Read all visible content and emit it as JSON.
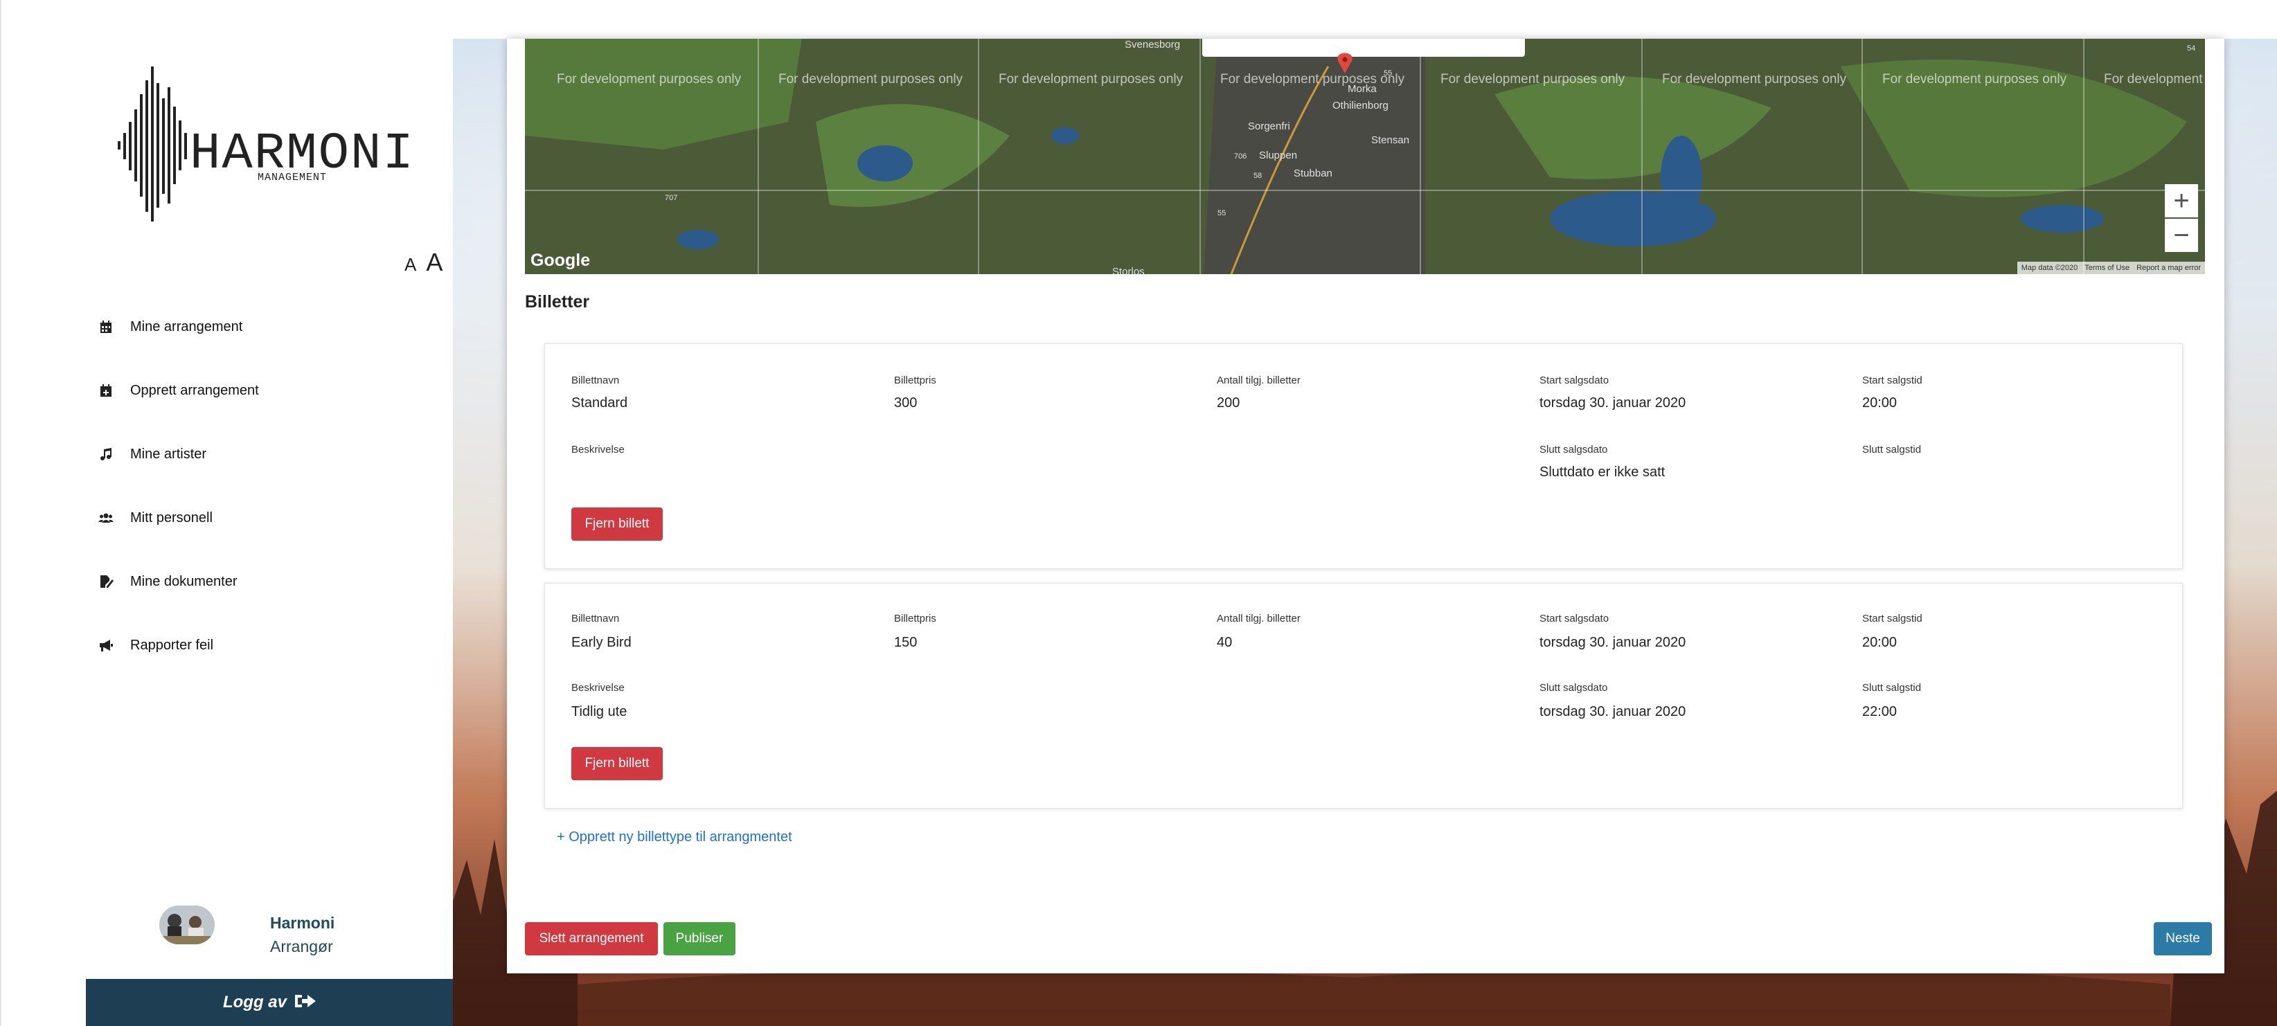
{
  "sidebar": {
    "logo": {
      "brand": "HARMONI",
      "tagline": "MANAGEMENT"
    },
    "font_size": {
      "small": "A",
      "large": "A"
    },
    "nav": [
      {
        "label": "Mine arrangement",
        "icon": "calendar-icon"
      },
      {
        "label": "Opprett arrangement",
        "icon": "calendar-plus-icon"
      },
      {
        "label": "Mine artister",
        "icon": "music-note-icon"
      },
      {
        "label": "Mitt personell",
        "icon": "users-icon"
      },
      {
        "label": "Mine dokumenter",
        "icon": "file-signature-icon"
      },
      {
        "label": "Rapporter feil",
        "icon": "megaphone-icon"
      }
    ],
    "user": {
      "name": "Harmoni",
      "role": "Arrangør"
    },
    "logout_label": "Logg av"
  },
  "map": {
    "watermark": "For development purposes only",
    "watermark_cut": "For development",
    "google": "Google",
    "zoom_in": "+",
    "zoom_out": "−",
    "attribution": [
      "Map data ©2020",
      "Terms of Use",
      "Report a map error"
    ],
    "places": [
      "Svenesborg",
      "Morka",
      "Othilienborg",
      "Sorgenfri",
      "Stensan",
      "Sluppen",
      "Stubban",
      "Storlos",
      "55",
      "55",
      "706",
      "58",
      "707",
      "54"
    ]
  },
  "tickets": {
    "heading": "Billetter",
    "labels": {
      "name": "Billettnavn",
      "price": "Billettpris",
      "count": "Antall tilgj. billetter",
      "start_date": "Start salgsdato",
      "start_time": "Start salgstid",
      "description": "Beskrivelse",
      "end_date": "Slutt salgsdato",
      "end_time": "Slutt salgstid"
    },
    "items": [
      {
        "name": "Standard",
        "price": "300",
        "count": "200",
        "start_date": "torsdag 30. januar 2020",
        "start_time": "20:00",
        "description": "",
        "end_date": "Sluttdato er ikke satt",
        "end_time": ""
      },
      {
        "name": "Early Bird",
        "price": "150",
        "count": "40",
        "start_date": "torsdag 30. januar 2020",
        "start_time": "20:00",
        "description": "Tidlig ute",
        "end_date": "torsdag 30. januar 2020",
        "end_time": "22:00"
      }
    ],
    "remove_label": "Fjern billett",
    "add_link": "+ Opprett ny billettype til arrangmentet"
  },
  "actions": {
    "delete": "Slett arrangement",
    "publish": "Publiser",
    "next": "Neste"
  },
  "colors": {
    "danger": "#d0393f",
    "success": "#4aa343",
    "primary": "#2c7aa6",
    "sidebar_dark": "#1d3e53",
    "link": "#1b6fd6"
  }
}
